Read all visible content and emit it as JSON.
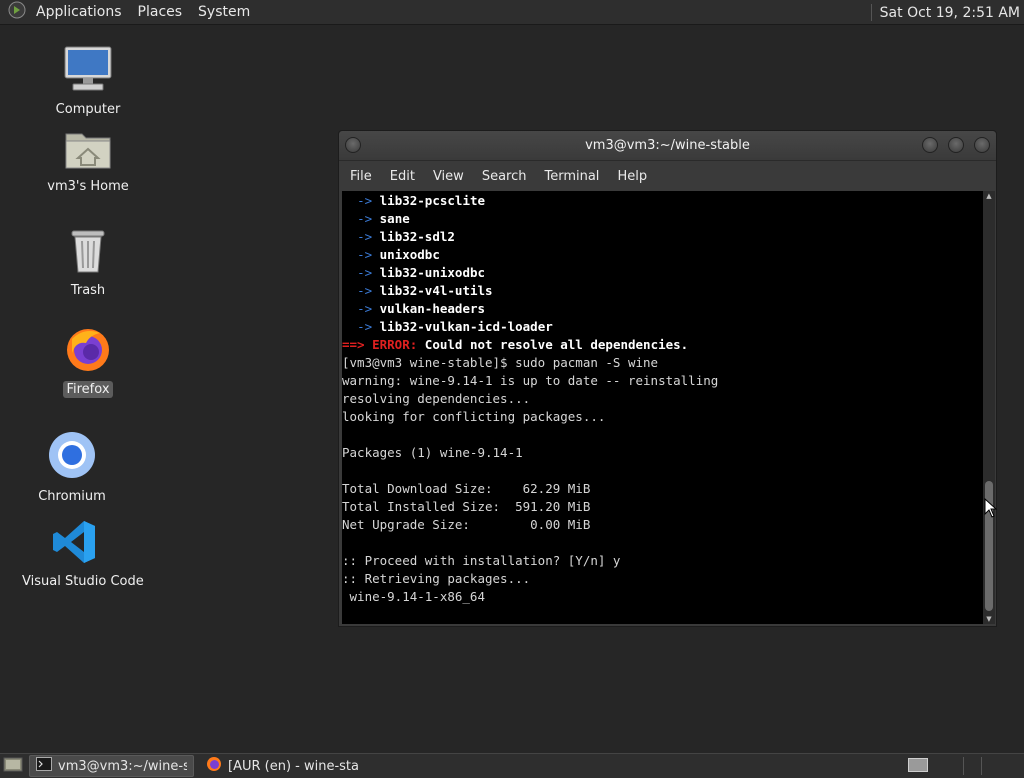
{
  "top_panel": {
    "menus": [
      "Applications",
      "Places",
      "System"
    ],
    "clock": "Sat Oct 19,  2:51 AM"
  },
  "desktop_icons": [
    {
      "label": "Computer",
      "icon": "computer-monitor-icon"
    },
    {
      "label": "vm3's Home",
      "icon": "home-folder-icon"
    },
    {
      "label": "Trash",
      "icon": "trash-bin-icon"
    },
    {
      "label": "Firefox",
      "icon": "firefox-icon"
    },
    {
      "label": "Chromium",
      "icon": "chromium-icon"
    },
    {
      "label": "Visual Studio Code",
      "icon": "vscode-icon"
    }
  ],
  "terminal": {
    "title": "vm3@vm3:~/wine-stable",
    "menu": [
      "File",
      "Edit",
      "View",
      "Search",
      "Terminal",
      "Help"
    ],
    "packages": [
      "lib32-pcsclite",
      "sane",
      "lib32-sdl2",
      "unixodbc",
      "lib32-unixodbc",
      "lib32-v4l-utils",
      "vulkan-headers",
      "lib32-vulkan-icd-loader"
    ],
    "error_arrow": "==>",
    "error_word": "ERROR:",
    "error_msg": "Could not resolve all dependencies.",
    "lines": [
      "[vm3@vm3 wine-stable]$ sudo pacman -S wine",
      "warning: wine-9.14-1 is up to date -- reinstalling",
      "resolving dependencies...",
      "looking for conflicting packages...",
      "",
      "Packages (1) wine-9.14-1",
      "",
      "Total Download Size:    62.29 MiB",
      "Total Installed Size:  591.20 MiB",
      "Net Upgrade Size:        0.00 MiB",
      "",
      ":: Proceed with installation? [Y/n] y",
      ":: Retrieving packages...",
      " wine-9.14-1-x86_64"
    ]
  },
  "taskbar": {
    "tasks": [
      {
        "label": "vm3@vm3:~/wine-s...",
        "icon": "terminal-icon",
        "active": true
      },
      {
        "label": "[AUR (en) - wine-sta...",
        "icon": "firefox-icon",
        "active": false
      }
    ]
  },
  "colors": {
    "desktop_bg": "#262626",
    "panel_bg": "#2e2e2e",
    "terminal_bg": "#000000",
    "arrow_blue": "#3c7cd8",
    "error_red": "#e02020"
  }
}
